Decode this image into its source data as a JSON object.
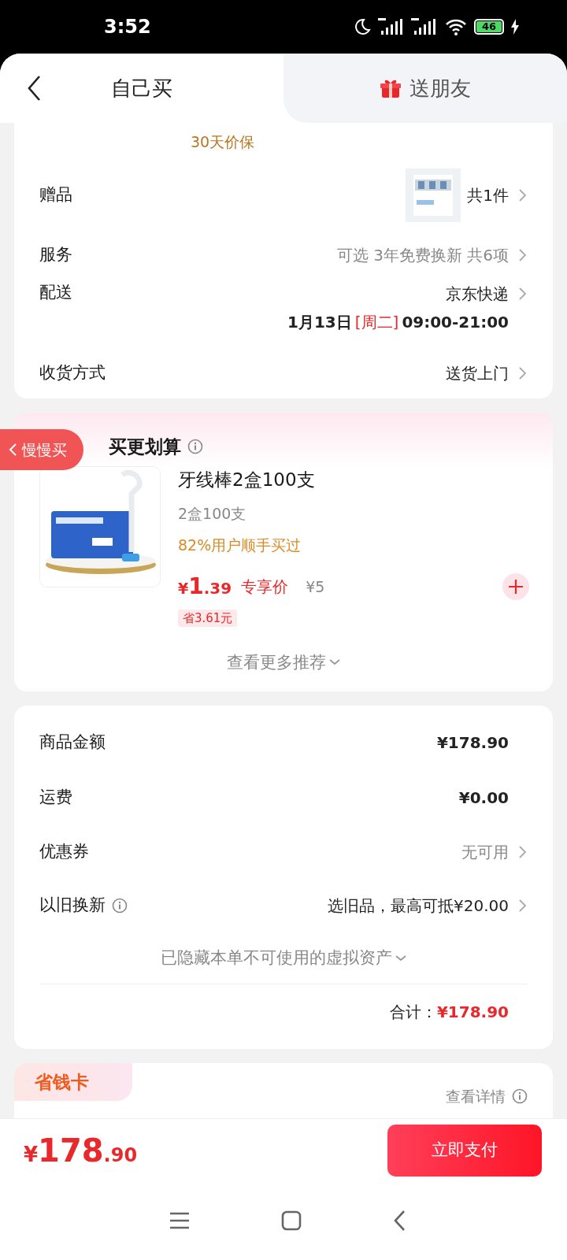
{
  "status_bar": {
    "time": "3:52",
    "battery": "46"
  },
  "tabs": [
    {
      "label": "自己买",
      "selected": true
    },
    {
      "label": "送朋友",
      "selected": false
    }
  ],
  "price_protect": "30天价保",
  "order_rows": [
    {
      "label": "赠品",
      "value": "共1件",
      "kind": "gift"
    },
    {
      "label": "服务",
      "value": "可选 3年免费换新 共6项",
      "kind": "muted"
    },
    {
      "label": "配送",
      "value": "京东快递",
      "date": "1月13日",
      "weekday": "[周二]",
      "time": "09:00-21:00",
      "kind": "delivery"
    },
    {
      "label": "收货方式",
      "value": "送货上门",
      "kind": "plain"
    }
  ],
  "addon": {
    "title": "买更划算",
    "float_button": "慢慢买",
    "product": {
      "name": "牙线棒2盒100支",
      "spec": "2盒100支",
      "bought": "82%用户顺手买过",
      "currency": "¥",
      "price_int": "1",
      "price_dec": ".39",
      "price_tag": "专享价",
      "orig_price": "¥5",
      "saving": "省3.61元"
    },
    "more": "查看更多推荐"
  },
  "summary": {
    "rows": [
      {
        "label": "商品金额",
        "value": "¥178.90",
        "kind": "amount",
        "info": false
      },
      {
        "label": "运费",
        "value": "¥0.00",
        "kind": "amount",
        "info": false
      },
      {
        "label": "优惠券",
        "value": "无可用",
        "kind": "link",
        "info": false
      },
      {
        "label": "以旧换新",
        "value": "选旧品，最高可抵¥20.00",
        "kind": "link",
        "info": true
      }
    ],
    "hidden_note": "已隐藏本单不可使用的虚拟资产",
    "total_label": "合计：",
    "total": "¥178.90"
  },
  "savings_card": {
    "title": "省钱卡",
    "details": "查看详情"
  },
  "bottom_bar": {
    "currency": "¥",
    "amount_int": "178",
    "amount_dec": ".90",
    "pay_button": "立即支付"
  }
}
